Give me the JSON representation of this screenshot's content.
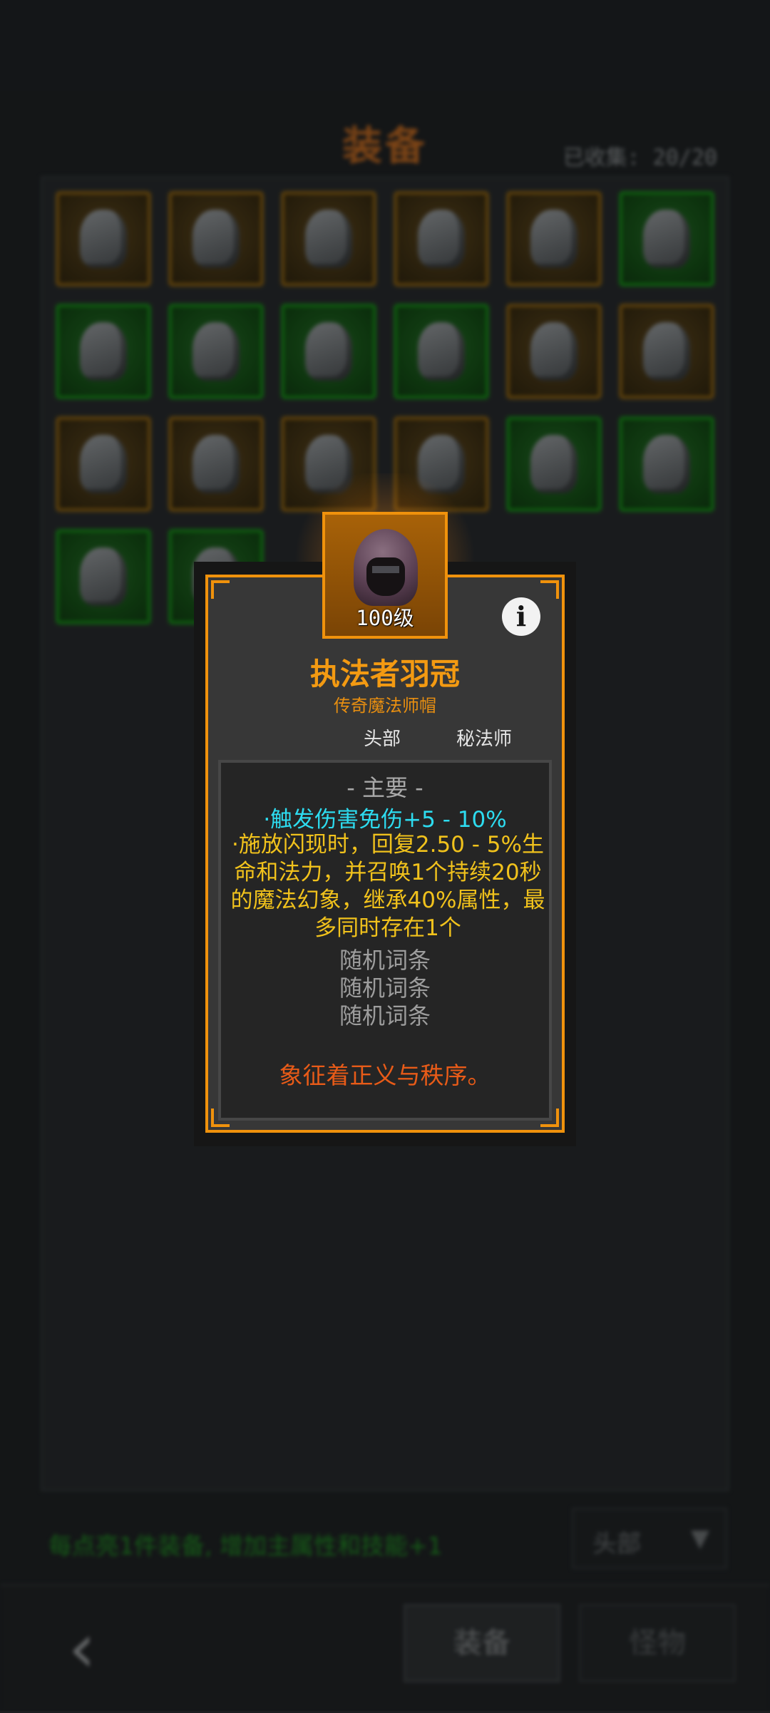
{
  "screen": {
    "title": "装备",
    "collected": "已收集: 20/20",
    "hint": "每点亮1件装备, 增加主属性和技能+1",
    "filter": {
      "selected": "头部",
      "arrow_icon": "triangle-down-icon"
    },
    "back_icon": "chevron-left-icon",
    "tabs": [
      "装备",
      "怪物"
    ]
  },
  "grid_slots": [
    {
      "rarity": "orange",
      "icon": "knight-helm-icon"
    },
    {
      "rarity": "orange",
      "icon": "samurai-helm-icon"
    },
    {
      "rarity": "orange",
      "icon": "red-mask-icon"
    },
    {
      "rarity": "orange",
      "icon": "gold-helm-icon"
    },
    {
      "rarity": "orange",
      "icon": "red-cap-icon"
    },
    {
      "rarity": "green",
      "icon": "cone-hat-icon"
    },
    {
      "rarity": "green",
      "icon": "bronze-helm-icon"
    },
    {
      "rarity": "green",
      "icon": "horned-helm-icon"
    },
    {
      "rarity": "green",
      "icon": "blue-hood-icon"
    },
    {
      "rarity": "green",
      "icon": "blue-cap-icon"
    },
    {
      "rarity": "orange",
      "icon": "purple-hat-icon"
    },
    {
      "rarity": "orange",
      "icon": "red-hood-icon"
    },
    {
      "rarity": "orange",
      "icon": "dark-helm-icon"
    },
    {
      "rarity": "orange",
      "icon": "steel-hood-icon"
    },
    {
      "rarity": "orange",
      "icon": "visor-helm-icon"
    },
    {
      "rarity": "orange",
      "icon": "black-helm-icon"
    },
    {
      "rarity": "green",
      "icon": "bat-wing-icon"
    },
    {
      "rarity": "green",
      "icon": "blue-crest-helm-icon"
    },
    {
      "rarity": "green",
      "icon": "red-hood-helm-icon"
    },
    {
      "rarity": "green",
      "icon": "gray-helm-icon"
    }
  ],
  "tooltip": {
    "level": "100级",
    "item_icon": "hooded-helm-icon",
    "info_icon": "info-icon",
    "name": "执法者羽冠",
    "subtitle": "传奇魔法师帽",
    "slot": "头部",
    "class": "秘法师",
    "section_header": "- 主要 -",
    "stat_primary": "·触发伤害免伤+5 - 10%",
    "stat_secondary": "·施放闪现时，回复2.50 - 5%生命和法力，并召唤1个持续20秒的魔法幻象，继承40%属性，最多同时存在1个",
    "random_affixes": [
      "随机词条",
      "随机词条",
      "随机词条"
    ],
    "lore": "象征着正义与秩序。",
    "colors": {
      "accent": "#f0920c",
      "cyan": "#2ddcf0",
      "yellow": "#f1c21c",
      "lore": "#e85b18"
    }
  }
}
